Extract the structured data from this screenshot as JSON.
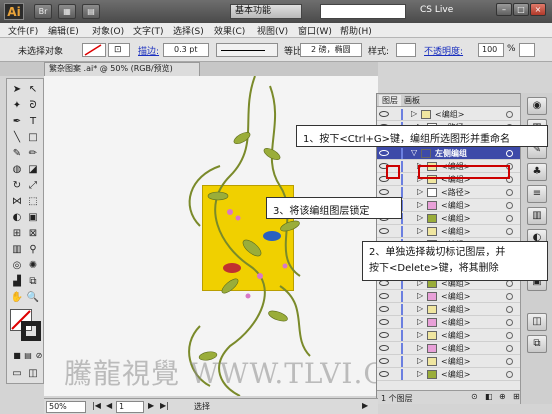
{
  "titlebar": {
    "logo": "Ai",
    "workspace": "基本功能",
    "cslive": "CS Live"
  },
  "menu": [
    "文件(F)",
    "编辑(E)",
    "对象(O)",
    "文字(T)",
    "选择(S)",
    "效果(C)",
    "视图(V)",
    "窗口(W)",
    "帮助(H)"
  ],
  "control": {
    "selection": "未选择对象",
    "stroke_label": "描边:",
    "stroke_value": "0.3 pt",
    "profile": "等比",
    "brush": "2 磅，椭圆",
    "style_label": "样式:",
    "opacity_label": "不透明度:",
    "opacity_value": "100",
    "opacity_unit": "%"
  },
  "document": {
    "tab": "繁杂图案 .ai* @ 50% (RGB/预览)",
    "zoom": "50%",
    "page": "1",
    "status": "选择"
  },
  "panel": {
    "tabs": [
      "图层",
      "画板"
    ],
    "rows": [
      {
        "name": "<编组>"
      },
      {
        "name": "<路径>"
      },
      {
        "name": "<路径>"
      },
      {
        "name": "左侧编组"
      },
      {
        "name": "<编组>"
      },
      {
        "name": "<编组>"
      },
      {
        "name": "<路径>"
      },
      {
        "name": "<编组>"
      },
      {
        "name": "<编组>"
      },
      {
        "name": "<编组>"
      },
      {
        "name": "<编组>"
      },
      {
        "name": "<编组>"
      },
      {
        "name": "<编组>"
      },
      {
        "name": "<编组>"
      },
      {
        "name": "<编组>"
      },
      {
        "name": "<编组>"
      },
      {
        "name": "<编组>"
      },
      {
        "name": "<编组>"
      },
      {
        "name": "<编组>"
      },
      {
        "name": "<编组>"
      },
      {
        "name": "<编组>"
      }
    ],
    "layer_count": "1 个图层"
  },
  "callouts": {
    "c1": "1、按下<Ctrl+G>键，编组所选图形并重命名",
    "c2": "3、将该编组图层锁定",
    "c3a": "2、单独选择裁切标记图层，并",
    "c3b": "按下<Delete>键，将其删除"
  },
  "watermark": "騰龍視覺 WWW.TLVI.COM",
  "colors": {
    "highlight": "#3d4aa8",
    "callout_border": "#cc0000",
    "artboard": "#f0d000"
  }
}
